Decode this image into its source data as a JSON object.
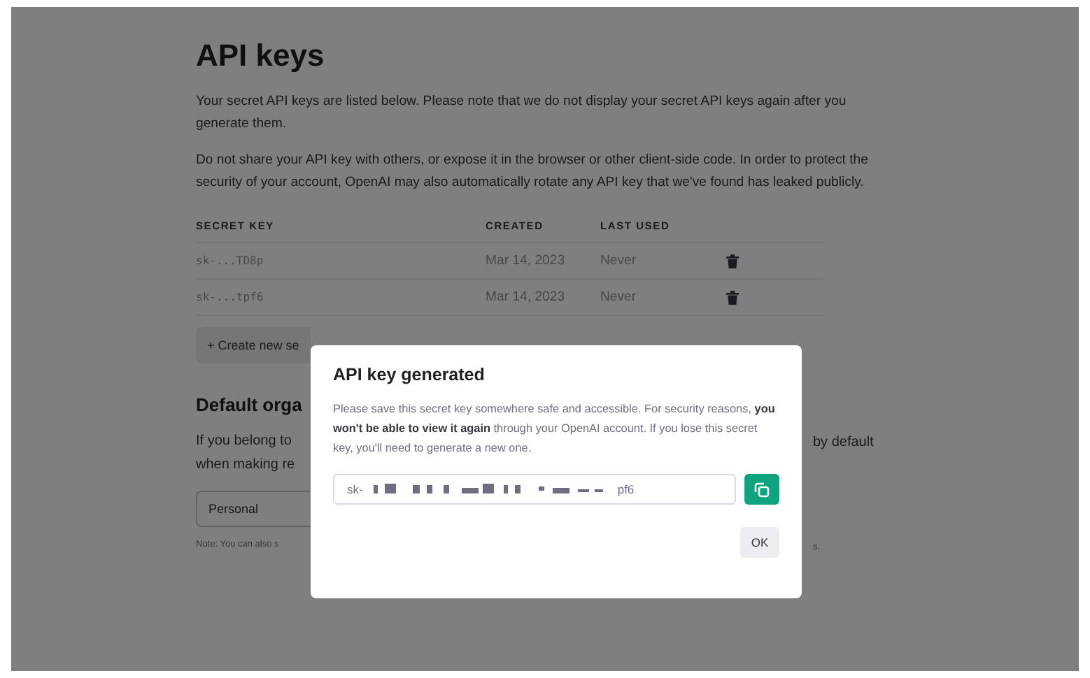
{
  "page": {
    "title": "API keys",
    "paragraphs": [
      "Your secret API keys are listed below. Please note that we do not display your secret API keys again after you generate them.",
      "Do not share your API key with others, or expose it in the browser or other client-side code. In order to protect the security of your account, OpenAI may also automatically rotate any API key that we've found has leaked publicly."
    ],
    "table": {
      "columns": [
        "SECRET KEY",
        "CREATED",
        "LAST USED"
      ],
      "rows": [
        {
          "key": "sk-...TD8p",
          "created": "Mar 14, 2023",
          "last_used": "Never"
        },
        {
          "key": "sk-...tpf6",
          "created": "Mar 14, 2023",
          "last_used": "Never"
        }
      ]
    },
    "create_button": "+ Create new se",
    "section_title": "Default orga",
    "section_text_left": [
      "If you belong to",
      "when making re"
    ],
    "section_text_right": "by default",
    "select_value": "Personal",
    "note_left": "Note: You can also s",
    "note_right": "s."
  },
  "dialog": {
    "title": "API key generated",
    "text": "Please save this secret key somewhere safe and accessible. For security reasons, **you won't be able to view it again** through your OpenAI account. If you lose this secret key, you'll need to generate a new one.",
    "key_start": "sk-",
    "key_end": "pf6",
    "ok_button": "OK"
  }
}
